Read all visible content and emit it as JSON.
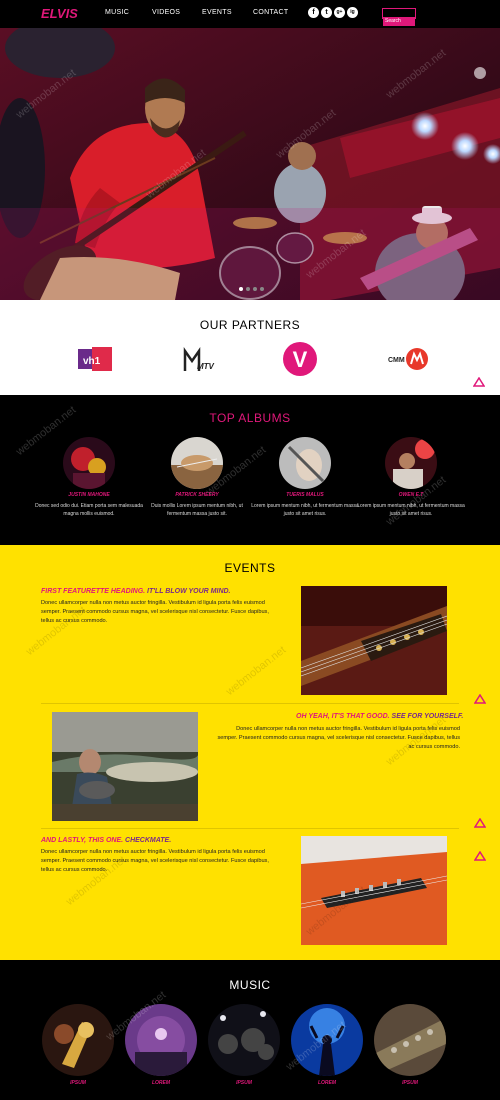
{
  "nav": {
    "logo": "ELVIS",
    "links": [
      "MUSIC",
      "VIDEOS",
      "EVENTS",
      "CONTACT"
    ],
    "social": [
      "f",
      "t",
      "g+",
      "ig"
    ],
    "search_placeholder": "Search"
  },
  "hero": {
    "slide_count": 4,
    "active_slide": 1
  },
  "partners": {
    "title": "OUR PARTNERS",
    "items": [
      "vh1",
      "MTV",
      "V",
      "CMM"
    ]
  },
  "albums": {
    "title": "TOP ALBUMS",
    "items": [
      {
        "name": "JUSTIN MAHONE",
        "text": "Donec sed odio dui. Etiam porta sem malesuada magna mollis euismod."
      },
      {
        "name": "PATRICK SHEERY",
        "text": "Duis mollis Lorem ipsum mentum nibh, ut fermentum massa justo sit."
      },
      {
        "name": "TUERIS MALUS",
        "text": "Lorem ipsum mentum nibh, ut fermentum massa justo sit amet risus."
      },
      {
        "name": "OWEN E.T",
        "text": "Lorem ipsum mentum nibh, ut fermentum massa justo sit amet risus."
      }
    ]
  },
  "events": {
    "title": "EVENTS",
    "items": [
      {
        "heading_a": "FIRST FEATURETTE HEADING.",
        "heading_b": " IT'LL BLOW YOUR MIND.",
        "body": "Donec ullamcorper nulla non metus auctor fringilla. Vestibulum id ligula porta felis euismod semper. Praesent commodo cursus magna, vel scelerisque nisl consectetur. Fusce dapibus, tellus ac cursus commodo."
      },
      {
        "heading_a": "OH YEAH, IT'S THAT GOOD.",
        "heading_b": " SEE FOR YOURSELF.",
        "body": "Donec ullamcorper nulla non metus auctor fringilla. Vestibulum id ligula porta felis euismod semper. Praesent commodo cursus magna, vel scelerisque nisl consectetur. Fusce dapibus, tellus ac cursus commodo."
      },
      {
        "heading_a": "AND LASTLY, THIS ONE.",
        "heading_b": " CHECKMATE.",
        "body": "Donec ullamcorper nulla non metus auctor fringilla. Vestibulum id ligula porta felis euismod semper. Praesent commodo cursus magna, vel scelerisque nisl consectetur. Fusce dapibus, tellus ac cursus commodo."
      }
    ]
  },
  "music": {
    "title": "MUSIC",
    "items": [
      "IPSUM",
      "LOREM",
      "IPSUM",
      "LOREM",
      "IPSUM"
    ]
  },
  "watermark": "webmoban.net",
  "colors": {
    "accent": "#e0187a",
    "events_bg": "#ffe100",
    "dark_bg": "#000000",
    "secondary": "#7a2a8a"
  }
}
